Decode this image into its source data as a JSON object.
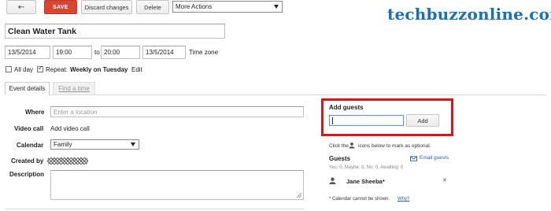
{
  "watermark": "techbuzzonline.com",
  "toolbar": {
    "back_icon": "←",
    "save_label": "SAVE",
    "discard_label": "Discard changes",
    "delete_label": "Delete",
    "more_actions_label": "More Actions"
  },
  "event": {
    "title": "Clean Water Tank",
    "start_date": "13/5/2014",
    "start_time": "19:00",
    "to_label": "to",
    "end_time": "20:00",
    "end_date": "13/5/2014",
    "timezone_link": "Time zone",
    "allday_label": "All day",
    "allday_checked": false,
    "repeat_checked": true,
    "repeat_label": "Repeat:",
    "repeat_value": "Weekly on Tuesday",
    "repeat_edit": "Edit"
  },
  "tabs": {
    "details": "Event details",
    "find_time": "Find a time"
  },
  "details": {
    "where_label": "Where",
    "where_placeholder": "Enter a location",
    "video_label": "Video call",
    "video_link": "Add video call",
    "calendar_label": "Calendar",
    "calendar_value": "Family",
    "created_label": "Created by",
    "description_label": "Description"
  },
  "guests": {
    "add_title": "Add guests",
    "add_button": "Add",
    "optional_hint_pre": "Click the",
    "optional_hint_post": "icons below to mark as optional.",
    "guests_title": "Guests",
    "email_link": "Email guests",
    "summary": "Yes: 0, Maybe: 0, No: 0, Awaiting: 0",
    "list": [
      {
        "name": "Jane Sheeba*"
      }
    ],
    "remove_icon": "✕",
    "footnote": "* Calendar cannot be shown.",
    "why_link": "Why?"
  },
  "colors": {
    "save": "#d64632",
    "link": "#2a5db0",
    "highlight": "#e0131b",
    "watermark": "#1a70b8"
  },
  "icons": {
    "back": "arrow-left-icon",
    "person": "person-icon",
    "mail": "mail-icon",
    "close": "close-icon"
  }
}
